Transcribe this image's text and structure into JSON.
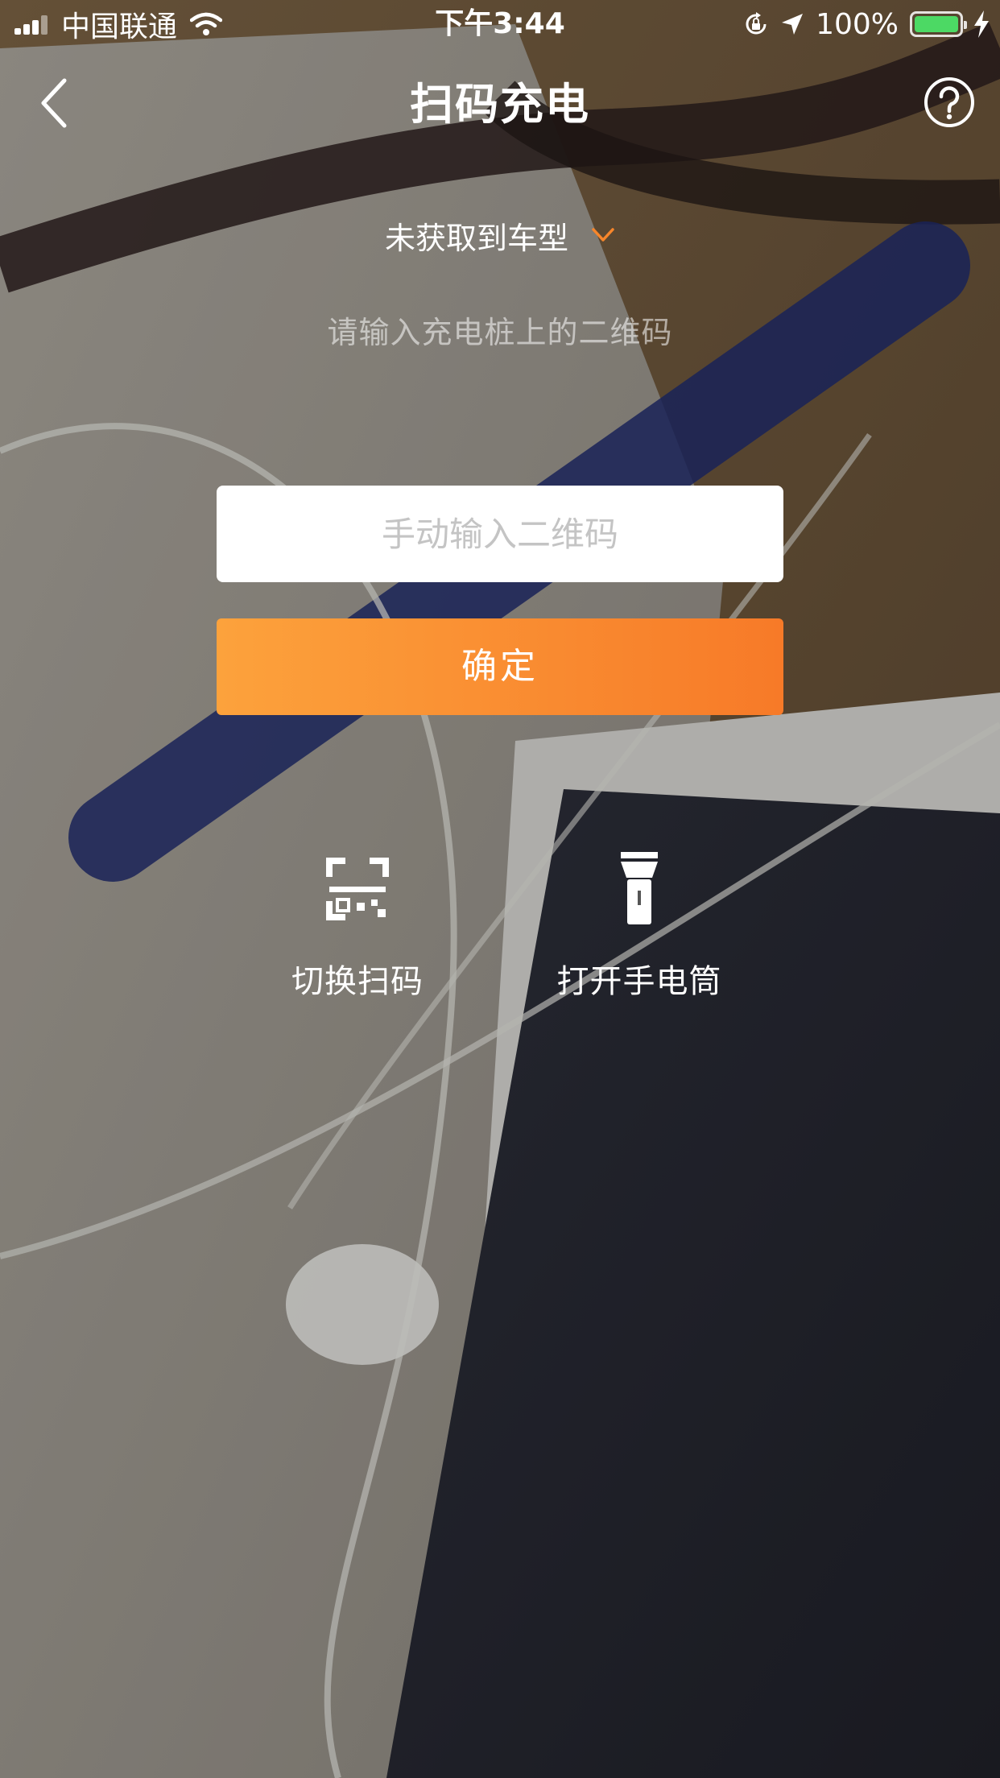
{
  "status_bar": {
    "carrier": "中国联通",
    "time": "下午3:44",
    "battery_percent": "100%",
    "battery_level": 1.0,
    "battery_color": "#4cd964",
    "icons": [
      "signal-icon",
      "wifi-icon",
      "rotation-lock-icon",
      "location-arrow-icon",
      "battery-icon",
      "charging-bolt-icon"
    ]
  },
  "nav": {
    "title": "扫码充电",
    "back_icon": "chevron-left-icon",
    "help_icon": "question-circle-icon"
  },
  "vehicle_selector": {
    "label": "未获取到车型",
    "icon": "chevron-down-icon",
    "icon_color": "#f7862b"
  },
  "hint": "请输入充电桩上的二维码",
  "manual_input": {
    "placeholder": "手动输入二维码",
    "value": ""
  },
  "confirm_button": {
    "label": "确定",
    "gradient": [
      "#fca23c",
      "#f77a28"
    ]
  },
  "actions": {
    "switch_scan": {
      "label": "切换扫码",
      "icon": "qr-scan-icon"
    },
    "flashlight": {
      "label": "打开手电筒",
      "icon": "flashlight-icon"
    }
  }
}
